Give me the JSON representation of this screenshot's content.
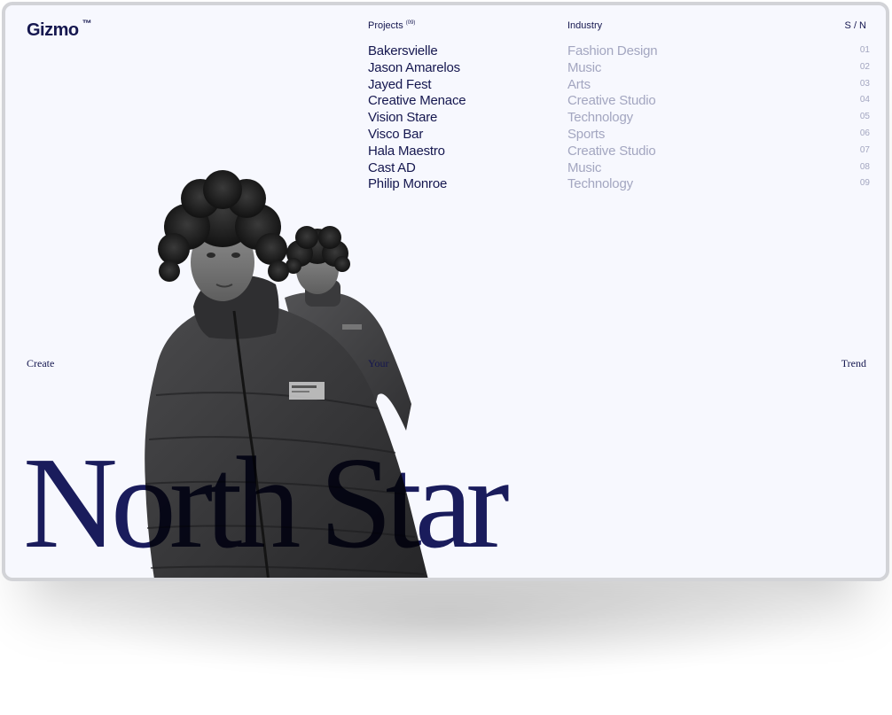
{
  "brand": {
    "name": "Gizmo",
    "mark": "™"
  },
  "columns": {
    "projects_label": "Projects",
    "projects_count": "(09)",
    "industry_label": "Industry",
    "sn_label": "S / N"
  },
  "projects": [
    {
      "name": "Bakersvielle",
      "industry": "Fashion Design",
      "number": "01"
    },
    {
      "name": "Jason Amarelos",
      "industry": "Music",
      "number": "02"
    },
    {
      "name": "Jayed Fest",
      "industry": "Arts",
      "number": "03"
    },
    {
      "name": "Creative Menace",
      "industry": "Creative Studio",
      "number": "04"
    },
    {
      "name": "Vision Stare",
      "industry": "Technology",
      "number": "05"
    },
    {
      "name": "Visco Bar",
      "industry": "Sports",
      "number": "06"
    },
    {
      "name": "Hala Maestro",
      "industry": "Creative Studio",
      "number": "07"
    },
    {
      "name": "Cast AD",
      "industry": "Music",
      "number": "08"
    },
    {
      "name": "Philip Monroe",
      "industry": "Technology",
      "number": "09"
    }
  ],
  "tagline": {
    "word1": "Create",
    "word2": "Your",
    "word3": "Trend"
  },
  "headline": "North Star",
  "colors": {
    "navy": "#15174f",
    "muted": "#a3a6c0",
    "background": "#f7f8fe",
    "frame_border": "#d2d3d7"
  }
}
